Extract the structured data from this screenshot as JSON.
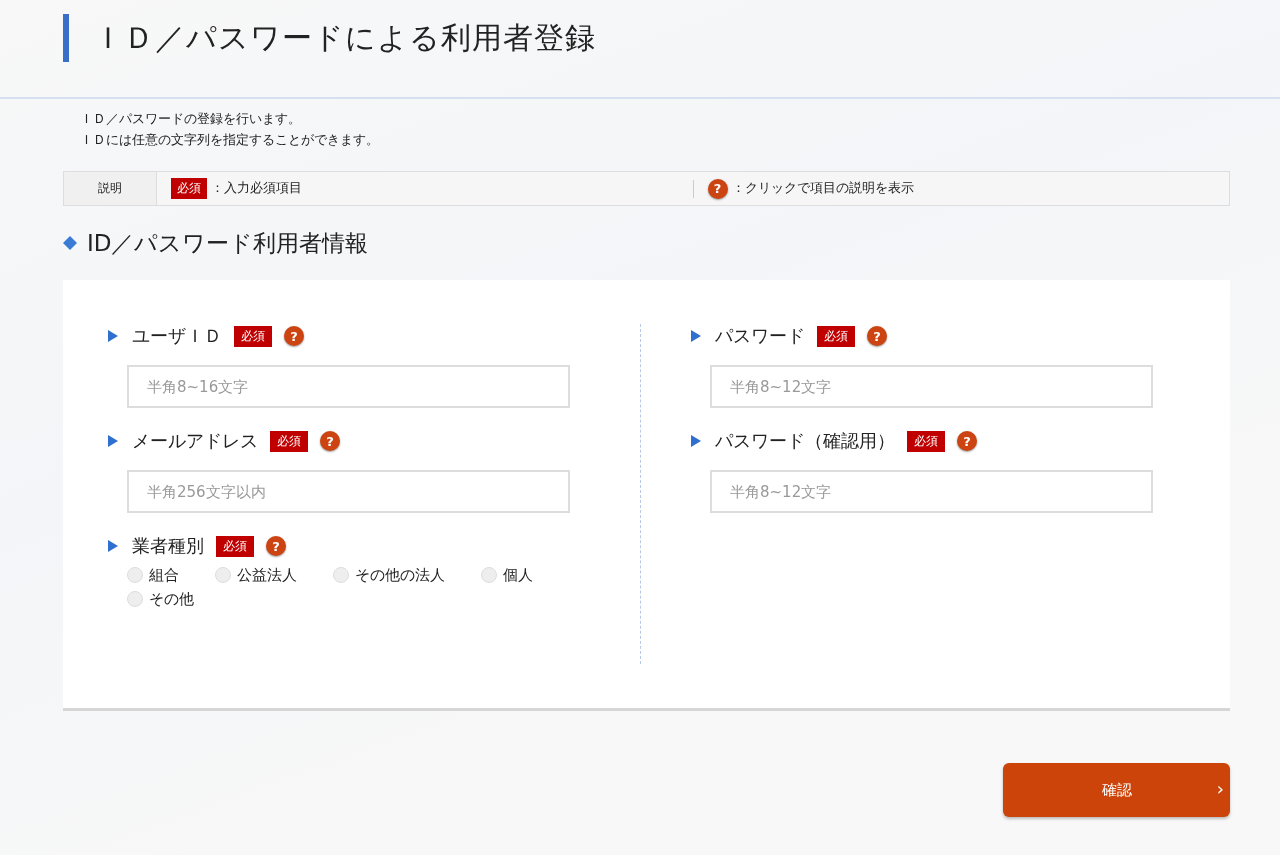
{
  "page_title": "ＩＤ／パスワードによる利用者登録",
  "intro": [
    "ＩＤ／パスワードの登録を行います。",
    "ＩＤには任意の文字列を指定することができます。"
  ],
  "legend": {
    "label": "説明",
    "required_badge": "必須",
    "required_text": "：入力必須項目",
    "help_icon": "?",
    "help_text": "：クリックで項目の説明を表示"
  },
  "section_title": "ID／パスワード利用者情報",
  "columns": [
    [
      {
        "kind": "text",
        "label": "ユーザＩＤ",
        "badge": "必須",
        "help": "?",
        "placeholder": "半角8~16文字"
      },
      {
        "kind": "text",
        "label": "メールアドレス",
        "badge": "必須",
        "help": "?",
        "placeholder": "半角256文字以内"
      },
      {
        "kind": "radio",
        "label": "業者種別",
        "badge": "必須",
        "help": "?",
        "options": [
          {
            "label": "組合",
            "selected": false
          },
          {
            "label": "公益法人",
            "selected": false
          },
          {
            "label": "その他の法人",
            "selected": false
          },
          {
            "label": "個人",
            "selected": false
          },
          {
            "label": "その他",
            "selected": false
          }
        ]
      }
    ],
    [
      {
        "kind": "text",
        "label": "パスワード",
        "badge": "必須",
        "help": "?",
        "placeholder": "半角8~12文字"
      },
      {
        "kind": "text",
        "label": "パスワード（確認用）",
        "badge": "必須",
        "help": "?",
        "placeholder": "半角8~12文字"
      }
    ]
  ],
  "confirm_button": {
    "label": "確認",
    "arrow": "›"
  }
}
